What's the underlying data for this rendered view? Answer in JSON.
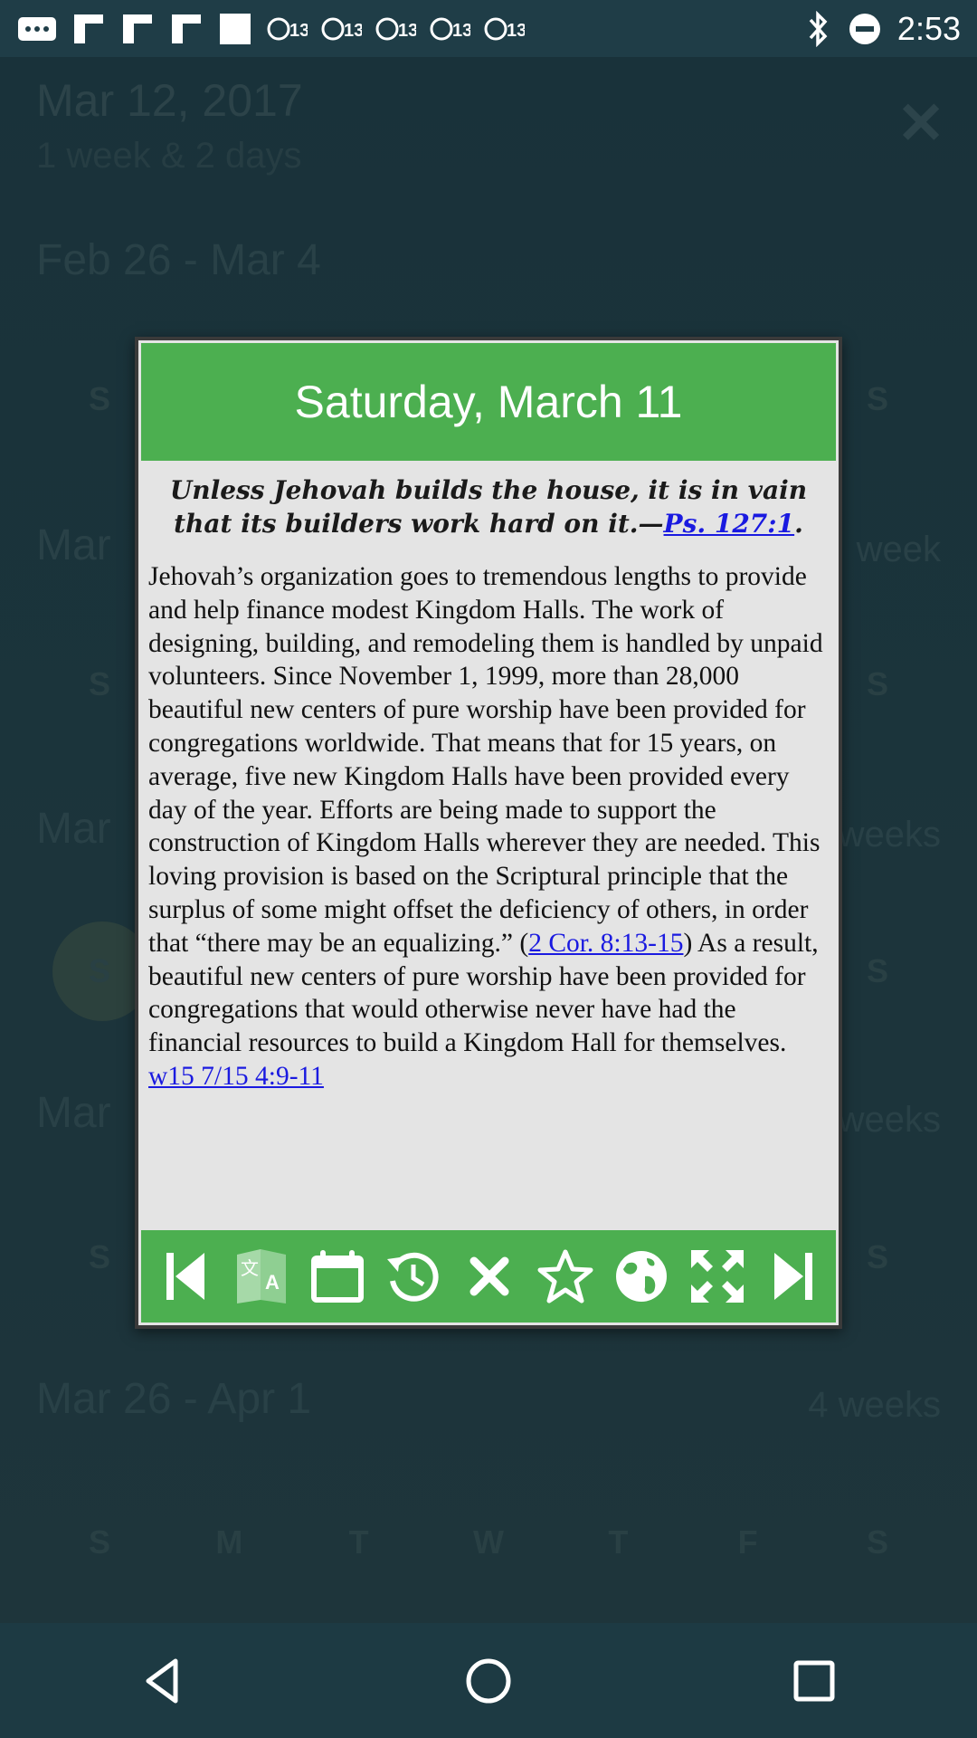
{
  "status_bar": {
    "time": "2:53",
    "left_icons": [
      "chat-icon",
      "flipboard-icon",
      "flipboard-icon",
      "flipboard-icon",
      "square-icon",
      "abc13-icon",
      "abc13-icon",
      "abc13-icon",
      "abc13-icon",
      "abc13-icon"
    ],
    "right_icons": [
      "bluetooth-icon",
      "minus-circle-icon"
    ]
  },
  "background": {
    "date": "Mar 12, 2017",
    "subtitle": "1 week & 2 days",
    "weeks": [
      {
        "label": "Feb 26 - Mar 4",
        "right": ""
      },
      {
        "label": "Mar",
        "right": "week"
      },
      {
        "label": "Mar",
        "right": "weeks"
      },
      {
        "label": "Mar",
        "right": "weeks"
      },
      {
        "label": "Mar 26 - Apr 1",
        "right": "4 weeks"
      }
    ],
    "day_letters": [
      "S",
      "M",
      "T",
      "W",
      "T",
      "F",
      "S"
    ]
  },
  "dialog": {
    "title": "Saturday, March 11",
    "theme_text": "Unless Jehovah builds the house, it is in vain that its builders work hard on it.—",
    "theme_ref": "Ps. 127:1",
    "theme_end": ".",
    "body_1": "Jehovah’s organization goes to tremendous lengths to provide and help finance modest Kingdom Halls. The work of designing, building, and remodeling them is handled by unpaid volunteers. Since November 1, 1999, more than 28,000 beautiful new centers of pure worship have been provided for congregations worldwide. That means that for 15 years, on average, five new Kingdom Halls have been provided every day of the year. Efforts are being made to support the construction of Kingdom Halls wherever they are needed. This loving provision is based on the Scriptural principle that the surplus of some might offset the deficiency of others, in order that “there may be an equalizing.” (",
    "body_ref_1": "2 Cor. 8:13-15",
    "body_2": ") As a result, beautiful new centers of pure worship have been provided for congregations that would otherwise never have had the financial resources to build a Kingdom Hall for themselves. ",
    "body_ref_2": "w15 7/15 4:9-11"
  },
  "toolbar": {
    "icons": [
      "skip-previous-icon",
      "translate-icon",
      "calendar-icon",
      "history-icon",
      "close-icon",
      "star-icon",
      "globe-icon",
      "fullscreen-icon",
      "skip-next-icon"
    ]
  },
  "nav": {
    "icons": [
      "back-icon",
      "home-icon",
      "recents-icon"
    ]
  },
  "colors": {
    "accent_green": "#4caf50",
    "link_blue": "#1a1ae0",
    "dialog_bg": "#e4e4e4"
  }
}
